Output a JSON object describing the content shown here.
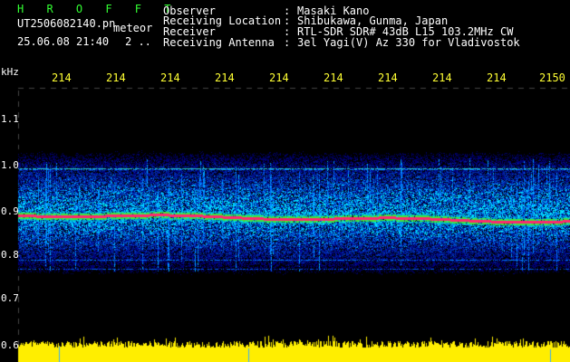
{
  "header": {
    "title": "H R O F F T",
    "filename": "UT2506082140.pn",
    "mode": "meteor",
    "datetime": "25.06.08 21:40",
    "count": "2 .."
  },
  "info": [
    {
      "label": "Observer",
      "value": "Masaki Kano"
    },
    {
      "label": "Receiving Location",
      "value": "Shibukawa, Gunma, Japan"
    },
    {
      "label": "Receiver",
      "value": "RTL-SDR SDR# 43dB L15 103.2MHz CW"
    },
    {
      "label": "Receiving Antenna",
      "value": "3el Yagi(V) Az 330 for Vladivostok"
    }
  ],
  "axes": {
    "y_unit": "kHz",
    "y_ticks": [
      "1.1",
      "1.0",
      "0.9",
      "0.8",
      "0.7",
      "0.6"
    ],
    "x_ticks": [
      "214",
      "214",
      "214",
      "214",
      "214",
      "214",
      "214",
      "214",
      "214",
      "2150"
    ]
  },
  "colors": {
    "title": "#33ff33",
    "axis_labels": "#ffff33",
    "trace": "#ff3366",
    "bottom_level": "#ffee00"
  }
}
